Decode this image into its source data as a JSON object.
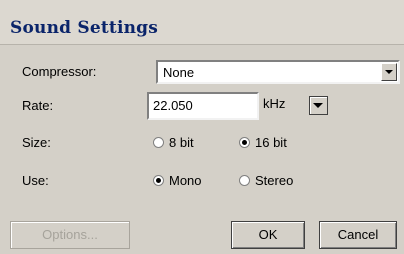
{
  "window": {
    "title": "Sound Settings"
  },
  "compressor": {
    "label": "Compressor:",
    "value": "None",
    "icon": "chevron-down-icon"
  },
  "rate": {
    "label": "Rate:",
    "value": "22.050",
    "unit": "kHz",
    "icon": "chevron-down-icon"
  },
  "size": {
    "label": "Size:",
    "options": [
      {
        "label": "8 bit",
        "selected": false
      },
      {
        "label": "16 bit",
        "selected": true
      }
    ]
  },
  "use": {
    "label": "Use:",
    "options": [
      {
        "label": "Mono",
        "selected": true
      },
      {
        "label": "Stereo",
        "selected": false
      }
    ]
  },
  "buttons": {
    "options": "Options...",
    "ok": "OK",
    "cancel": "Cancel"
  }
}
